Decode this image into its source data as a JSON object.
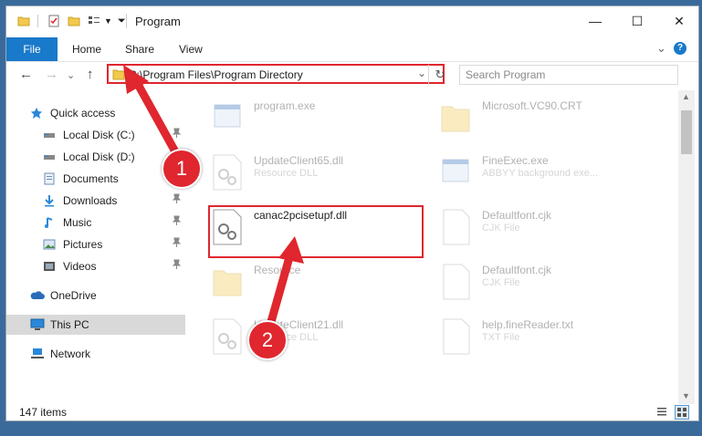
{
  "window": {
    "title": "Program",
    "controls": {
      "minimize": "—",
      "maximize": "☐",
      "close": "✕"
    }
  },
  "ribbon": {
    "tabs": [
      "File",
      "Home",
      "Share",
      "View"
    ],
    "help_icon": "?",
    "expand_icon": "⌄"
  },
  "navbar": {
    "back": "←",
    "forward": "→",
    "recent": "⌄",
    "up": "↑",
    "address": "C:\\Program Files\\Program Directory",
    "address_dropdown": "⌄",
    "refresh": "↻",
    "search_placeholder": "Search Program"
  },
  "sidebar": {
    "items": [
      {
        "label": "Quick access",
        "icon": "star-icon",
        "pinned": false
      },
      {
        "label": "Local Disk (C:)",
        "icon": "drive-icon",
        "pinned": true
      },
      {
        "label": "Local Disk (D:)",
        "icon": "drive-icon",
        "pinned": false
      },
      {
        "label": "Documents",
        "icon": "documents-icon",
        "pinned": true
      },
      {
        "label": "Downloads",
        "icon": "download-icon",
        "pinned": true
      },
      {
        "label": "Music",
        "icon": "music-icon",
        "pinned": true
      },
      {
        "label": "Pictures",
        "icon": "pictures-icon",
        "pinned": true
      },
      {
        "label": "Videos",
        "icon": "videos-icon",
        "pinned": true
      },
      {
        "label": "OneDrive",
        "icon": "cloud-icon",
        "pinned": false
      },
      {
        "label": "This PC",
        "icon": "pc-icon",
        "pinned": false
      },
      {
        "label": "Network",
        "icon": "network-icon",
        "pinned": false
      }
    ],
    "pin_glyph": "📌"
  },
  "files": [
    {
      "name": "program.exe",
      "type": ""
    },
    {
      "name": "Microsoft.VC90.CRT",
      "type": ""
    },
    {
      "name": "UpdateClient65.dll",
      "type": "Resource DLL"
    },
    {
      "name": "FineExec.exe",
      "type": "ABBYY background exe..."
    },
    {
      "name": "canac2pcisetupf.dll",
      "type": ""
    },
    {
      "name": "Defaultfont.cjk",
      "type": "CJK File"
    },
    {
      "name": "Resource",
      "type": ""
    },
    {
      "name": "Defaultfont.cjk",
      "type": "CJK File"
    },
    {
      "name": "UpdateClient21.dll",
      "type": "Resource DLL"
    },
    {
      "name": "help.fineReader.txt",
      "type": "TXT File"
    }
  ],
  "annotations": {
    "badge1": "1",
    "badge2": "2"
  },
  "status": {
    "item_count": "147 items"
  },
  "colors": {
    "accent": "#1979ca",
    "annotation_red": "#e0262e"
  }
}
